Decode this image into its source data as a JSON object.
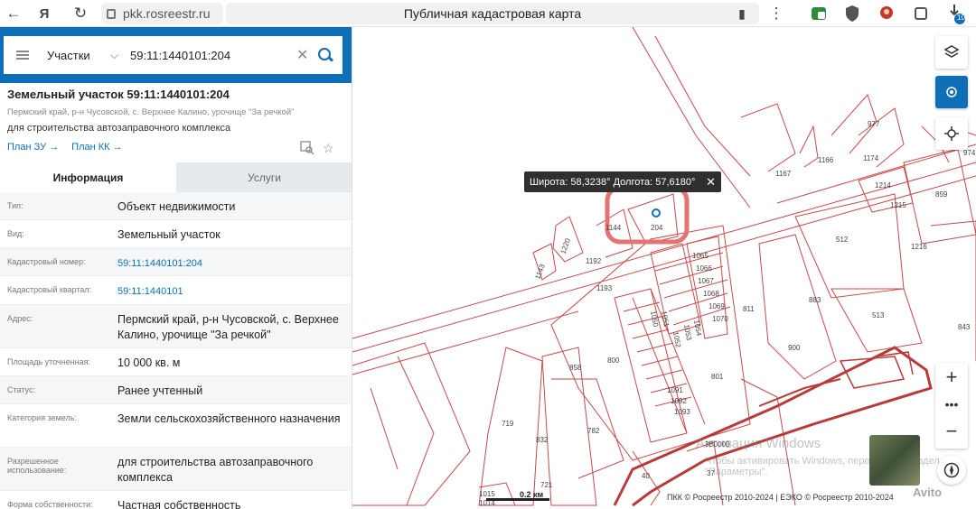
{
  "browser": {
    "url": "pkk.rosreestr.ru",
    "page_title": "Публичная кадастровая карта",
    "downloads_badge": "10"
  },
  "search": {
    "type": "Участки",
    "value": "59:11:1440101:204"
  },
  "parcel": {
    "title": "Земельный участок 59:11:1440101:204",
    "address": "Пермский край, р-н Чусовской, с. Верхнее Калино, урочище \"За речкой\"",
    "purpose": "для строительства автозаправочного комплекса",
    "plan_zu": "План ЗУ",
    "plan_kk": "План КК"
  },
  "tabs": {
    "info": "Информация",
    "services": "Услуги"
  },
  "rows": [
    {
      "label": "Тип:",
      "value": "Объект недвижимости"
    },
    {
      "label": "Вид:",
      "value": "Земельный участок"
    },
    {
      "label": "Кадастровый номер:",
      "value": "59:11:1440101:204"
    },
    {
      "label": "Кадастровый квартал:",
      "value": "59:11:1440101"
    },
    {
      "label": "Адрес:",
      "value": "Пермский край, р-н Чусовской, с. Верхнее Калино, урочище \"За речкой\""
    },
    {
      "label": "Площадь уточненная:",
      "value": "10 000 кв. м"
    },
    {
      "label": "Статус:",
      "value": "Ранее учтенный"
    },
    {
      "label": "Категория земель:",
      "value": "Земли сельскохозяйственного назначения"
    },
    {
      "label": "Разрешенное использование:",
      "value": "для строительства автозаправочного комплекса"
    },
    {
      "label": "Форма собственности:",
      "value": "Частная собственность"
    }
  ],
  "map": {
    "coord_popup": "Широта: 58,3238° Долгота: 57,6180°",
    "scale": "0.2 км",
    "copyright": "ПКК © Росреестр 2010-2024 | ЕЭКО © Росреестр 2010-2024",
    "watermark_title": "Активация Windows",
    "watermark_sub": "Чтобы активировать Windows, перейдите в раздел \"Параметры\".",
    "watermark_brand": "Avito",
    "parcel_labels": [
      "204",
      "1144",
      "1220",
      "1143",
      "1192",
      "1193",
      "1050",
      "1051",
      "1052",
      "1053",
      "1054",
      "1065",
      "1066",
      "1067",
      "1068",
      "1069",
      "1070",
      "811",
      "800",
      "858",
      "801",
      "883",
      "900",
      "512",
      "513",
      "1216",
      "1214",
      "1215",
      "859",
      "977",
      "1174",
      "1166",
      "1167",
      "974",
      "843",
      "719",
      "832",
      "782",
      "1091",
      "1092",
      "1093",
      "3В0000",
      "37",
      "40",
      "1015",
      "1014",
      "721"
    ]
  },
  "colors": {
    "accent": "#0e6fb8",
    "parcel_line": "#c84a4a",
    "highlight": "#e57373"
  }
}
